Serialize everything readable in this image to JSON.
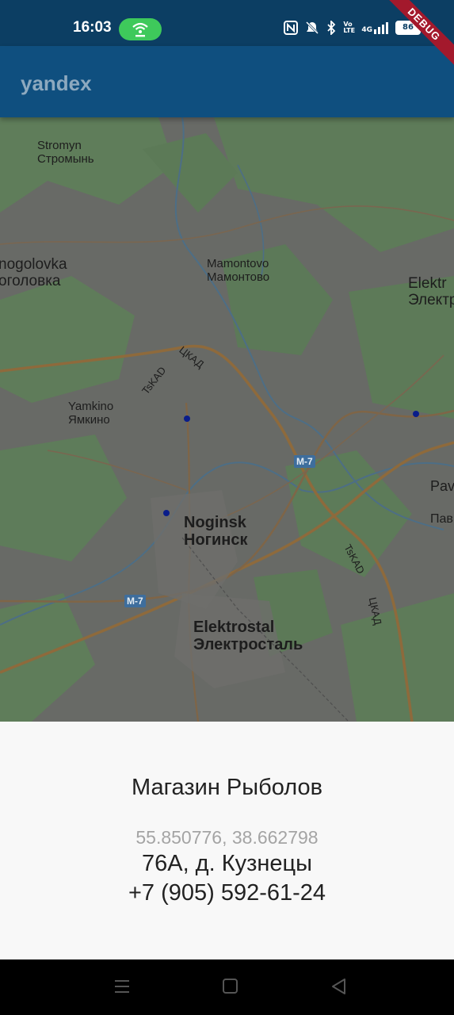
{
  "status_bar": {
    "time": "16:03",
    "icons": [
      "wifi-hotspot-icon",
      "nfc-icon",
      "mute-icon",
      "bluetooth-icon",
      "volte-icon",
      "signal-4g-icon",
      "battery-icon"
    ],
    "volte": "Vo LTE",
    "network": "4G",
    "battery": "86"
  },
  "debug_banner": "DEBUG",
  "appbar": {
    "title": "yandex"
  },
  "map": {
    "labels": [
      {
        "en": "Stromyn",
        "ru": "Стромынь"
      },
      {
        "en": "nogolovka",
        "ru": "оголовка"
      },
      {
        "en": "Mamontovo",
        "ru": "Мамонтово"
      },
      {
        "en": "Elektr",
        "ru": "Электр"
      },
      {
        "en": "Yamkino",
        "ru": "Ямкино"
      },
      {
        "en": "Noginsk",
        "ru": "Ногинск"
      },
      {
        "en": "Elektrostal",
        "ru": "Электросталь"
      },
      {
        "en": "Pav",
        "ru": "Пав"
      }
    ],
    "road_badges": [
      "M-7",
      "M-7"
    ],
    "ring_labels": [
      "TsKAD",
      "ЦКАД",
      "TsKAD",
      "ЦКАД"
    ]
  },
  "place": {
    "name": "Магазин Рыболов",
    "coordinates": "55.850776, 38.662798",
    "address": "76А, д. Кузнецы",
    "phone": "+7 (905) 592-61-24"
  },
  "nav_bar": {
    "buttons": [
      "menu-icon",
      "home-icon",
      "back-icon"
    ]
  }
}
